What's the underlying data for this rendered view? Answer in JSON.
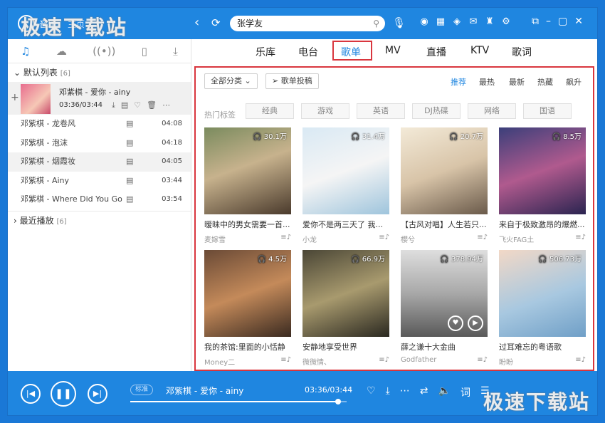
{
  "app": {
    "logo_text": "音乐",
    "nav_text": "主页",
    "watermark": "极速下载站"
  },
  "search": {
    "query": "张学友"
  },
  "sidebar": {
    "group_default": {
      "label": "默认列表",
      "count": "[6]"
    },
    "now_playing": {
      "title": "邓紫棋 - 爱你 - ainy",
      "time": "03:36/03:44"
    },
    "songs": [
      {
        "title": "邓紫棋 - 龙卷风",
        "duration": "04:08"
      },
      {
        "title": "邓紫棋 - 泡沫",
        "duration": "04:18"
      },
      {
        "title": "邓紫棋 - 烟霞妆",
        "duration": "04:05"
      },
      {
        "title": "邓紫棋 - Ainy",
        "duration": "03:44"
      },
      {
        "title": "邓紫棋 - Where Did You Go",
        "duration": "03:54"
      }
    ],
    "group_recent": {
      "label": "最近播放",
      "count": "[6]"
    }
  },
  "main_tabs": [
    "乐库",
    "电台",
    "歌单",
    "MV",
    "直播",
    "KTV",
    "歌词"
  ],
  "active_tab": "歌单",
  "filters": {
    "category": "全部分类",
    "submit": "歌单投稿",
    "sorts": [
      "推荐",
      "最热",
      "最新",
      "热藏",
      "飙升"
    ],
    "hot_label": "热门标签",
    "tags": [
      "经典",
      "游戏",
      "英语",
      "DJ热碟",
      "网络",
      "国语"
    ]
  },
  "playlists": [
    {
      "title": "暧昧中的男女需要一首...",
      "author": "麦嫁雪",
      "plays": "30.1万"
    },
    {
      "title": "爱你不是两三天了 我...",
      "author": "小龙",
      "plays": "31.4万"
    },
    {
      "title": "【古风对唱】人生若只...",
      "author": "櫻兮",
      "plays": "20.7万"
    },
    {
      "title": "来自于极致激昂的爆燃...",
      "author": "飞火FAG⼟",
      "plays": "8.5万"
    },
    {
      "title": "我的茶馆:里面的小恬静",
      "author": "Money二",
      "plays": "4.5万"
    },
    {
      "title": "安静地享受世界",
      "author": "微微情、",
      "plays": "66.9万"
    },
    {
      "title": "薛之谦十大金曲",
      "author": "Godfather",
      "plays": "378.94万"
    },
    {
      "title": "过耳难忘的粤语歌",
      "author": "盼盼",
      "plays": "506.73万"
    }
  ],
  "player": {
    "quality": "标准",
    "title": "邓紫棋 - 爱你 - ainy",
    "time": "03:36/03:44",
    "progress": 0.96
  }
}
